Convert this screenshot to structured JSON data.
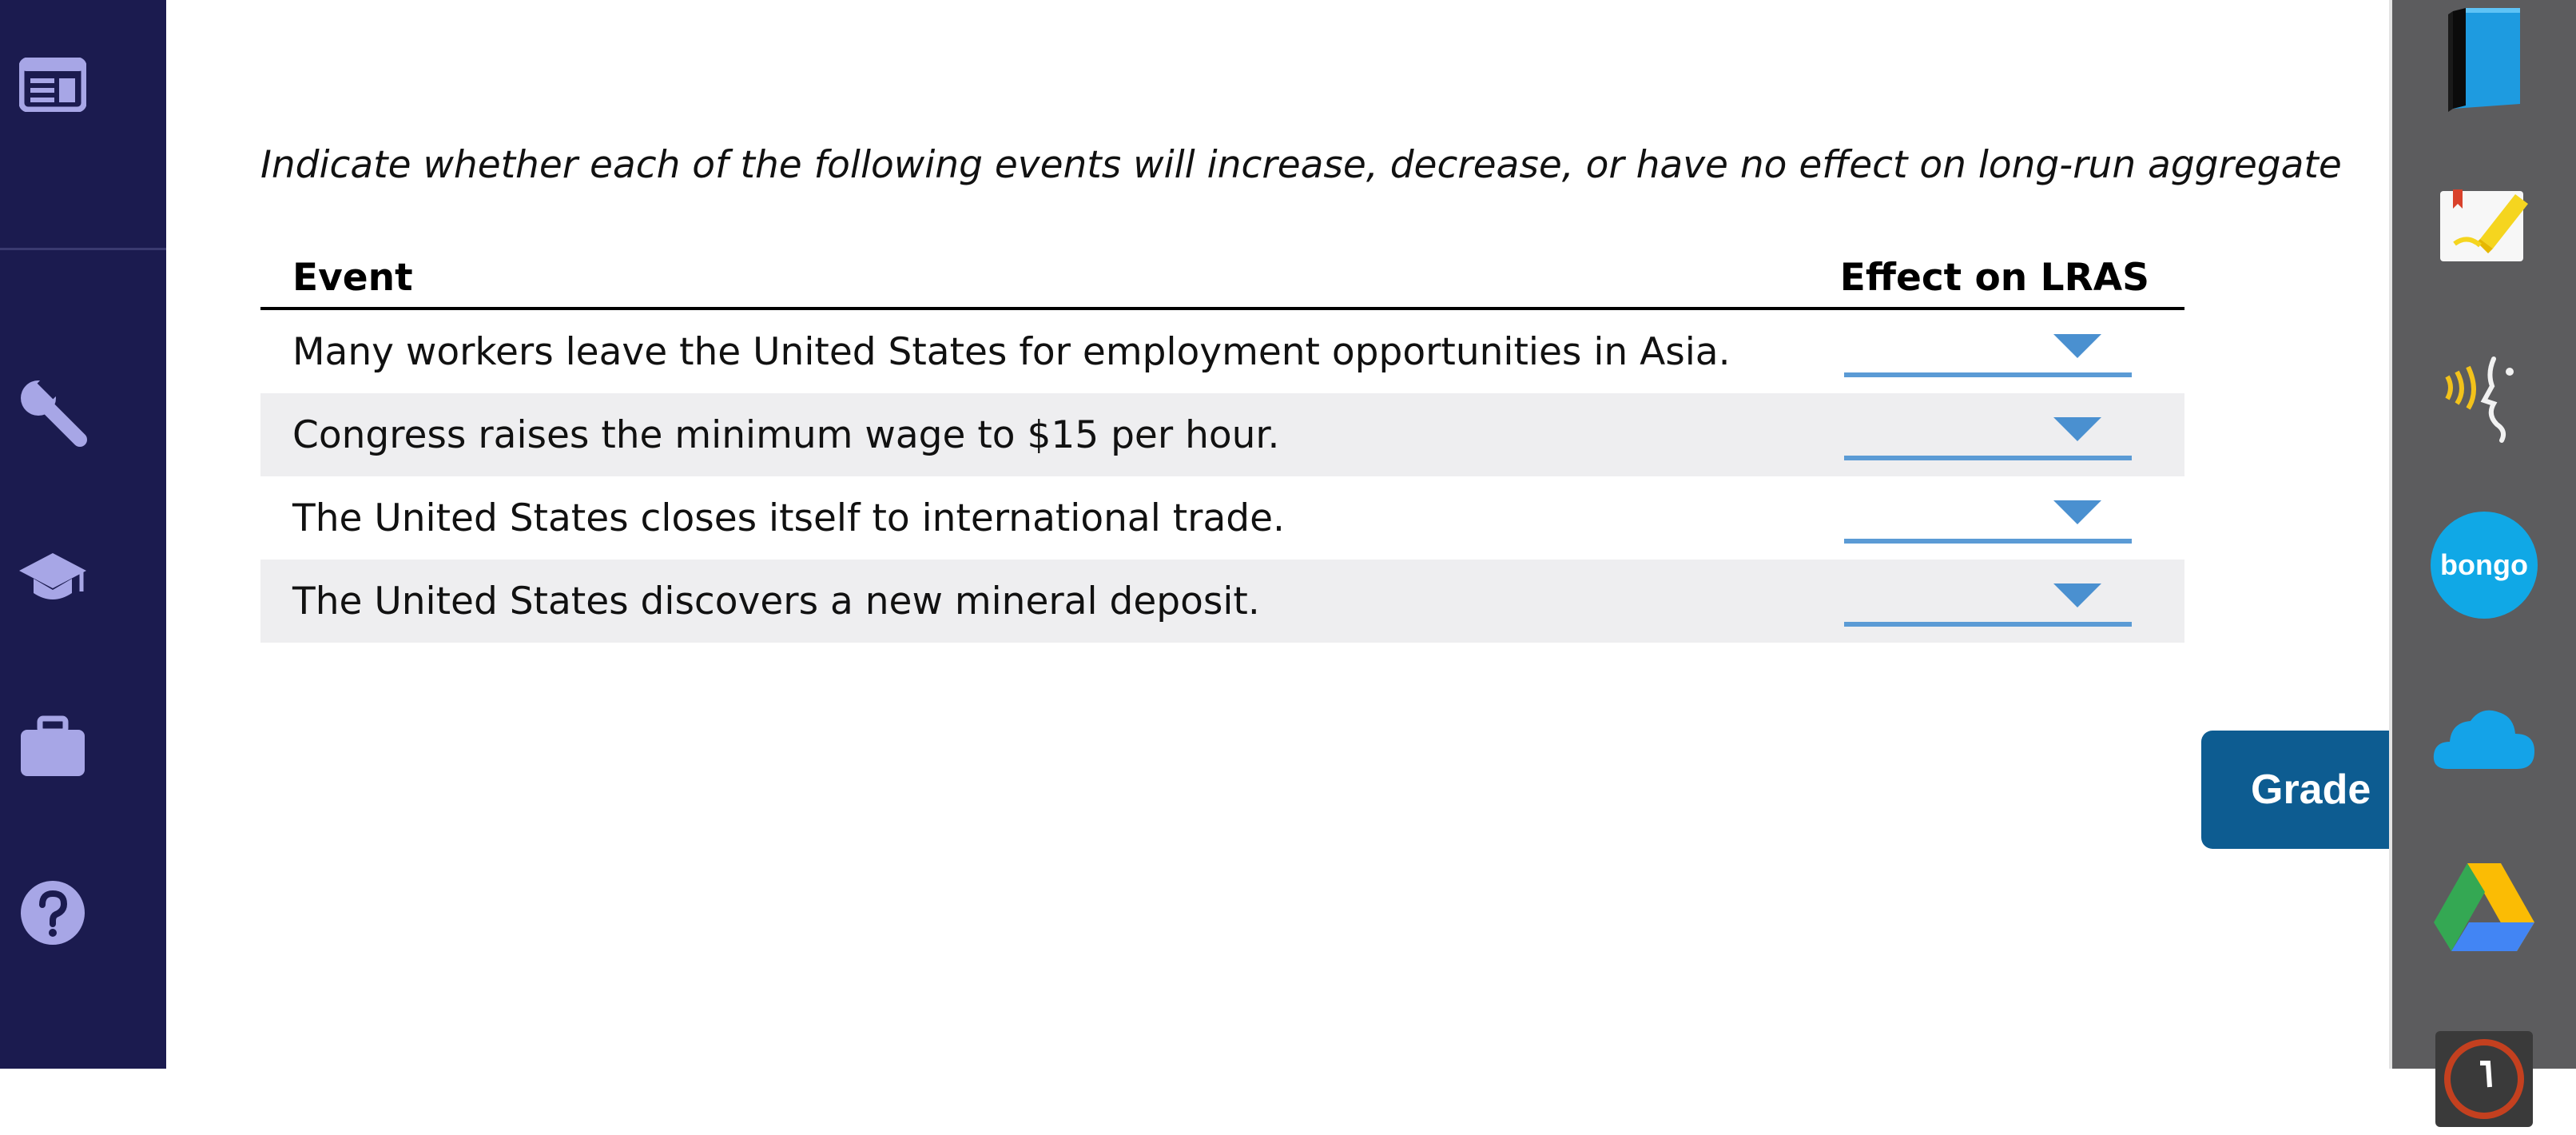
{
  "nav": {
    "items": [
      {
        "name": "news-icon"
      },
      {
        "name": "wrench-icon"
      },
      {
        "name": "graduation-cap-icon"
      },
      {
        "name": "briefcase-icon"
      },
      {
        "name": "help-icon"
      }
    ],
    "background": "#1b1b4f",
    "icon_color": "#a7a6e6"
  },
  "question": {
    "instructions": "Indicate whether each of the following events will increase, decrease, or have no effect on long-run aggregate"
  },
  "table": {
    "headers": {
      "event": "Event",
      "effect": "Effect on LRAS"
    },
    "rows": [
      {
        "event": "Many workers leave the United States for employment opportunities in Asia.",
        "selected": ""
      },
      {
        "event": "Congress raises the minimum wage to $15 per hour.",
        "selected": ""
      },
      {
        "event": "The United States closes itself to international trade.",
        "selected": ""
      },
      {
        "event": "The United States discovers a new mineral deposit.",
        "selected": ""
      }
    ]
  },
  "grade_button": {
    "label": "Grade",
    "color": "#0d5c91"
  },
  "dock": {
    "apps": [
      {
        "name": "book-app-icon"
      },
      {
        "name": "highlighter-app-icon"
      },
      {
        "name": "read-aloud-app-icon"
      },
      {
        "name": "bongo-app-icon",
        "label": "bongo"
      },
      {
        "name": "onedrive-cloud-icon"
      },
      {
        "name": "google-drive-icon"
      },
      {
        "name": "partial-app-icon"
      }
    ],
    "background": "#5c5c5e"
  }
}
